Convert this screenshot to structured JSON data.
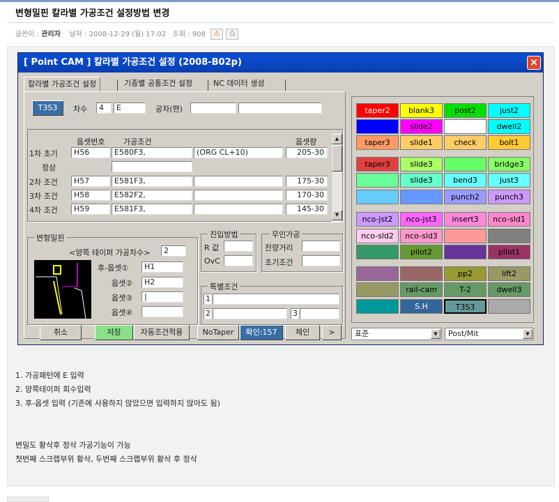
{
  "post": {
    "title": "변형밀핀 칼라별 가공조건 설정방법 변경",
    "author_label": "글쓴이 :",
    "author": "관리자",
    "date_label": "날자 :",
    "date": "2008-12-29 (월) 17:02",
    "views_label": "조회 :",
    "views": "908"
  },
  "window": {
    "title": "[ Point CAM ]  칼라별 가공조건 설정  (2008-B02p)",
    "close": "×"
  },
  "tabs": [
    "칼라별 가공조건 설정",
    "기종별 공통조건 설정",
    "NC 데이터 생성"
  ],
  "top": {
    "mode_btn": "T3S3",
    "chasu_label": "차수",
    "chasu_value": "4",
    "chasu_letter": "E",
    "tol_label": "공차(편)",
    "tol1": "",
    "tol2": ""
  },
  "table": {
    "headers": {
      "offset_no": "옵셋번호",
      "condition": "가공조건",
      "offset_amt": "옵셋량"
    },
    "rows": [
      {
        "label": "1차 초기",
        "offset": "H56",
        "cond": "E580F3,",
        "extra": "(ORG CL+10)",
        "amt": "205-30"
      },
      {
        "label": "정상",
        "offset": "",
        "cond": "",
        "extra": "",
        "amt": ""
      },
      {
        "label": "2차 조건",
        "offset": "H57",
        "cond": "E581F3,",
        "extra": "",
        "amt": "175-30"
      },
      {
        "label": "3차 조건",
        "offset": "H58",
        "cond": "E582F2,",
        "extra": "",
        "amt": "170-30"
      },
      {
        "label": "4차 조건",
        "offset": "H59",
        "cond": "E581F3,",
        "extra": "",
        "amt": "145-30"
      }
    ]
  },
  "pin": {
    "group": "변형밀핀",
    "taper_label": "<양쪽 테이퍼 가공차수>",
    "taper_value": "2",
    "offsets": [
      {
        "label": "후-옵셋①",
        "value": "H1"
      },
      {
        "label": "옵셋②",
        "value": "H2"
      },
      {
        "label": "옵셋③",
        "value": "|"
      },
      {
        "label": "옵셋④",
        "value": ""
      }
    ]
  },
  "approach": {
    "group": "진입방법",
    "r_label": "R 값",
    "r_value": "",
    "ovc_label": "OvC",
    "ovc_value": ""
  },
  "unmanned": {
    "group": "무인가공",
    "remain_label": "잔량거리",
    "remain_value": "",
    "init_label": "초기조건",
    "init_value": ""
  },
  "special": {
    "group": "특별조건",
    "row1_no": "1",
    "row1_value": "",
    "row2_no": "2",
    "row2_value": "",
    "row3_no": "3",
    "row3_value": ""
  },
  "buttons": {
    "cancel": "취소",
    "save": "저장",
    "auto": "자동조건적용",
    "notaper": "NoTaper",
    "confirm": "확인:157",
    "chain": "체인",
    "next": ">"
  },
  "combos": {
    "standard": "표준",
    "postmit": "Post/Mit",
    "arrow": "▼"
  },
  "colors": [
    [
      {
        "t": "taper2",
        "bg": "#ff0000",
        "fg": "#fff"
      },
      {
        "t": "blank3",
        "bg": "#ffff00",
        "fg": "#000"
      },
      {
        "t": "post2",
        "bg": "#00e000",
        "fg": "#000"
      },
      {
        "t": "just2",
        "bg": "#00ffff",
        "fg": "#000"
      }
    ],
    [
      {
        "t": "",
        "bg": "#0000ff",
        "fg": "#fff"
      },
      {
        "t": "slide2",
        "bg": "#ff00ff",
        "fg": "#000"
      },
      {
        "t": "",
        "bg": "#ffffff",
        "fg": "#000"
      },
      {
        "t": "dwell2",
        "bg": "#00ffff",
        "fg": "#000"
      }
    ],
    [
      {
        "t": "taper3",
        "bg": "#ff9966",
        "fg": "#000"
      },
      {
        "t": "slide1",
        "bg": "#ffcc66",
        "fg": "#000"
      },
      {
        "t": "check",
        "bg": "#ffcc66",
        "fg": "#000"
      },
      {
        "t": "bolt1",
        "bg": "#ffcc33",
        "fg": "#000"
      }
    ],
    [
      {
        "t": "taper3",
        "bg": "#e04040",
        "fg": "#000"
      },
      {
        "t": "slide3",
        "bg": "#aaff66",
        "fg": "#000"
      },
      {
        "t": "",
        "bg": "#66ff66",
        "fg": "#000"
      },
      {
        "t": "bridge3",
        "bg": "#88ff66",
        "fg": "#000"
      }
    ],
    [
      {
        "t": "",
        "bg": "#66ff99",
        "fg": "#000"
      },
      {
        "t": "slide3",
        "bg": "#66ffcc",
        "fg": "#000"
      },
      {
        "t": "bend3",
        "bg": "#66ffff",
        "fg": "#000"
      },
      {
        "t": "just3",
        "bg": "#66ffff",
        "fg": "#000"
      }
    ],
    [
      {
        "t": "",
        "bg": "#66ccff",
        "fg": "#000"
      },
      {
        "t": "",
        "bg": "#6699ff",
        "fg": "#000"
      },
      {
        "t": "punch2",
        "bg": "#9999ff",
        "fg": "#000"
      },
      {
        "t": "punch3",
        "bg": "#cc99ff",
        "fg": "#000"
      }
    ],
    [
      {
        "t": "nco-jst2",
        "bg": "#cc99ff",
        "fg": "#000"
      },
      {
        "t": "nco-jst3",
        "bg": "#ff66ff",
        "fg": "#000"
      },
      {
        "t": "insert3",
        "bg": "#ff88dd",
        "fg": "#000"
      },
      {
        "t": "nco-sld1",
        "bg": "#ff88cc",
        "fg": "#000"
      }
    ],
    [
      {
        "t": "nco-sld2",
        "bg": "#ffccee",
        "fg": "#000"
      },
      {
        "t": "nco-sld3",
        "bg": "#ff99cc",
        "fg": "#000"
      },
      {
        "t": "",
        "bg": "#ff9999",
        "fg": "#000"
      },
      {
        "t": "",
        "bg": "#808080",
        "fg": "#000"
      }
    ],
    [
      {
        "t": "",
        "bg": "#339966",
        "fg": "#000"
      },
      {
        "t": "pilot2",
        "bg": "#669933",
        "fg": "#000"
      },
      {
        "t": "",
        "bg": "#663399",
        "fg": "#000"
      },
      {
        "t": "pilot1",
        "bg": "#993366",
        "fg": "#000"
      }
    ],
    [
      {
        "t": "",
        "bg": "#996699",
        "fg": "#000"
      },
      {
        "t": "",
        "bg": "#996666",
        "fg": "#000"
      },
      {
        "t": "pp2",
        "bg": "#999933",
        "fg": "#000"
      },
      {
        "t": "lift2",
        "bg": "#999966",
        "fg": "#000"
      }
    ],
    [
      {
        "t": "",
        "bg": "#999966",
        "fg": "#000"
      },
      {
        "t": "rail-cam",
        "bg": "#669966",
        "fg": "#000"
      },
      {
        "t": "T-2",
        "bg": "#669966",
        "fg": "#000"
      },
      {
        "t": "dwell3",
        "bg": "#669966",
        "fg": "#000"
      }
    ],
    [
      {
        "t": "",
        "bg": "#009999",
        "fg": "#000"
      },
      {
        "t": "S.H",
        "bg": "#336699",
        "fg": "#fff"
      },
      {
        "t": "T3S3",
        "bg": "#669999",
        "fg": "#000"
      },
      {
        "t": "",
        "bg": "#aaaaaa",
        "fg": "#000"
      }
    ]
  ],
  "notes": [
    "1. 가공패턴에 E 입력",
    "2. 양쪽테이퍼 회수입력",
    "3. 후-옵셋 입력 (기존에 사용하지 않았으면 입력하지 않아도 됨)",
    "변밀도 황삭후 정삭 가공기능이 가능",
    "첫번째 스크랩부위 황삭, 두번째 스크랩부위 황삭 후 정삭"
  ]
}
